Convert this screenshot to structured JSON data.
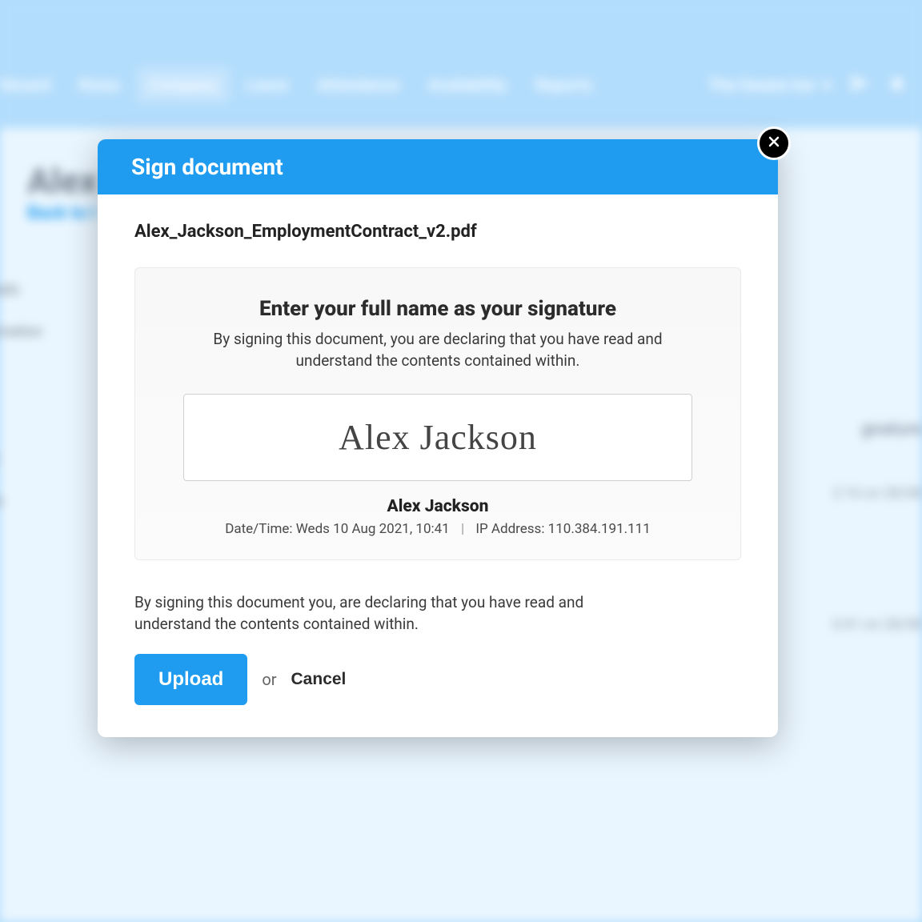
{
  "nav": {
    "items": [
      "hboard",
      "Rotas",
      "Company",
      "Leave",
      "Attendance",
      "Availability",
      "Reports"
    ],
    "active_index": 2,
    "venue": "The Swann Inn"
  },
  "page": {
    "heading": "Alex .",
    "back": "Back to l",
    "side_items": [
      "tails",
      "rmation",
      "7",
      "le"
    ],
    "right_snips": {
      "signature": "gnature",
      "t1": "2:16 on 28/08",
      "t2": "0:41 on 28/08"
    }
  },
  "modal": {
    "title": "Sign document",
    "filename": "Alex_Jackson_EmploymentContract_v2.pdf",
    "sig_title": "Enter your full name as your signature",
    "sig_sub": "By signing this document, you are declaring that you have read and understand the contents contained within.",
    "input_value": "Alex Jackson",
    "confirmed_name": "Alex Jackson",
    "datetime_label": "Date/Time:",
    "datetime_value": "Weds 10 Aug 2021, 10:41",
    "ip_label": "IP Address:",
    "ip_value": "110.384.191.111",
    "disclaimer": "By signing this document you, are declaring that you have read and understand the contents contained within.",
    "upload_label": "Upload",
    "or_label": "or",
    "cancel_label": "Cancel"
  }
}
